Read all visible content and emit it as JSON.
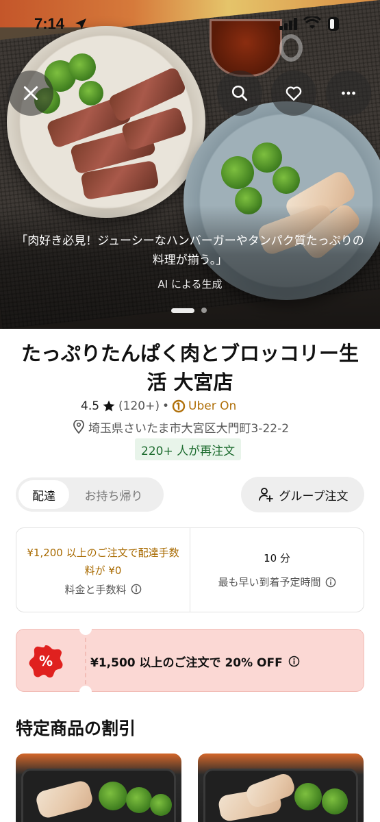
{
  "status_bar": {
    "time": "7:14"
  },
  "hero": {
    "tagline": "「肉好き必見！ジューシーなハンバーガーやタンパク質たっぷりの料理が揃う。」",
    "ai_note": "AI による生成",
    "icons": [
      "close-icon",
      "search-icon",
      "heart-icon",
      "more-icon"
    ],
    "pager": {
      "count": 2,
      "active": 1
    }
  },
  "store": {
    "name": "たっぷりたんぱく肉とブロッコリー生活 大宮店",
    "rating": "4.5",
    "review_count": "(120+)",
    "separator": "•",
    "membership": "Uber On",
    "address": "埼玉県さいたま市大宮区大門町3-22-2",
    "reorder_badge": "220+ 人が再注文"
  },
  "order_mode": {
    "options": [
      "配達",
      "お持ち帰り"
    ],
    "selected": "配達"
  },
  "group_order": {
    "label": "グループ注文"
  },
  "info_card": {
    "fee_promo": "¥1,200 以上のご注文で配達手数料が ¥0",
    "fee_label": "料金と手数料",
    "eta_value": "10 分",
    "eta_label": "最も早い到着予定時間"
  },
  "promo": {
    "text": "¥1,500 以上のご注文で 20% OFF"
  },
  "section": {
    "title": "特定商品の割引"
  },
  "colors": {
    "accent_green_bg": "#e8f4ea",
    "accent_green_text": "#1c6b2e",
    "fee_gold": "#a86a00",
    "promo_bg": "#fbd8d4",
    "promo_icon": "#e0211f"
  }
}
